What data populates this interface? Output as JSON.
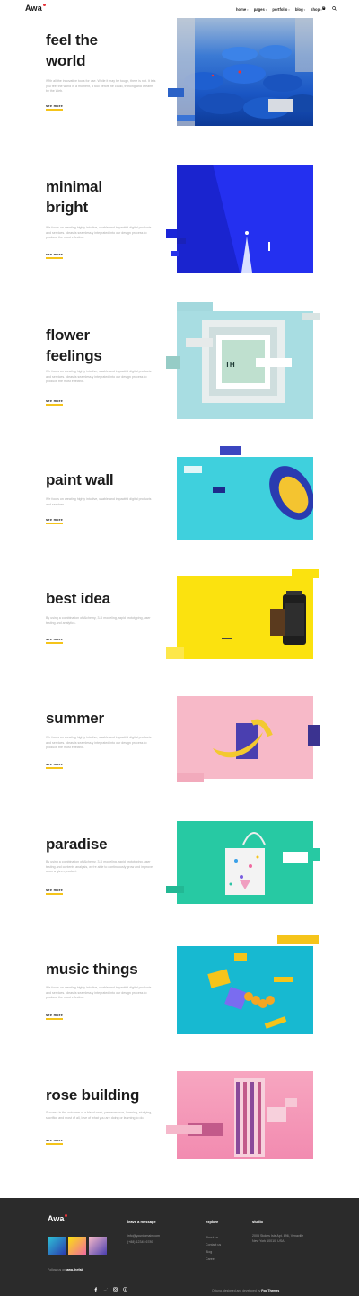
{
  "header": {
    "logo": "Awa",
    "nav": [
      {
        "label": "home",
        "dropdown": true
      },
      {
        "label": "pages",
        "dropdown": true
      },
      {
        "label": "portfolio",
        "dropdown": true
      },
      {
        "label": "blog",
        "dropdown": true
      },
      {
        "label": "shop",
        "dropdown": true
      }
    ],
    "icons": [
      "cart-icon",
      "search-icon"
    ]
  },
  "sections": [
    {
      "title": [
        "feel the",
        "world"
      ],
      "desc": "With all the innovative tools for use. While it may be tough, there is not. It lets you feel the world in a moment, a tool before he could, thinking and dreams by the Web.",
      "more": "see more",
      "image": "blue-umbrellas"
    },
    {
      "title": [
        "minimal",
        "bright"
      ],
      "desc": "We focus on creating highly intuitive, usable and impactful digital products and services. Ideas is seamlessly integrated into our design process to produce the most effective.",
      "more": "see more",
      "image": "blue-wall"
    },
    {
      "title": [
        "flower",
        "feelings"
      ],
      "desc": "We focus on creating highly intuitive, usable and impactful digital products and services. Ideas is seamlessly integrated into our design process to produce the most effective.",
      "more": "see more",
      "image": "frame-mockup"
    },
    {
      "title": [
        "paint wall"
      ],
      "desc": "We focus on creating highly intuitive, usable and impactful digital products and services.",
      "more": "see more",
      "image": "cyan-sneaker"
    },
    {
      "title": [
        "best idea"
      ],
      "desc": "By using a combination of Alchemy, 3-D modeling, rapid prototyping, user testing and analytics.",
      "more": "see more",
      "image": "film-roll"
    },
    {
      "title": [
        "summer"
      ],
      "desc": "We focus on creating highly intuitive, usable and impactful digital products and services. Ideas is seamlessly integrated into our design process to produce the most effective.",
      "more": "see more",
      "image": "banana"
    },
    {
      "title": [
        "paradise"
      ],
      "desc": "By using a combination of Alchemy, 3-D modeling, rapid prototyping, user testing and contents analysis, we're able to continuously grow and improve upon a given product.",
      "more": "see more",
      "image": "tote-bag"
    },
    {
      "title": [
        "music things"
      ],
      "desc": "We focus on creating highly intuitive, usable and impactful digital products and services. Ideas is seamlessly integrated into our design process to produce the most effective.",
      "more": "see more",
      "image": "music-things"
    },
    {
      "title": [
        "rose building"
      ],
      "desc": "Success is the outcome of a blend work, perseverance, learning, studying, sacrifice and most of all, love of what you are doing or learning to do.",
      "more": "see more",
      "image": "pink-building"
    }
  ],
  "footer": {
    "logo": "Awa",
    "follow_prefix": "Follow us on",
    "follow_handle": "awa.thefab",
    "message_heading": "leave a message",
    "email": "info@yourdomain.com",
    "phone": "(+88) 12345 6789",
    "explore_heading": "explore",
    "explore_links": [
      "About us",
      "Contact us",
      "Blog",
      "Career"
    ],
    "studio_heading": "studio",
    "address": "2005 Stokes Isle Apt. 896, Venaville New York 10010, USA",
    "copyright_prefix": "Ostuna, designed and developed by",
    "copyright_brand": "Foo Themes",
    "social": [
      "facebook-icon",
      "twitter-icon",
      "instagram-icon",
      "pinterest-icon"
    ]
  },
  "colors": {
    "accent": "#f5c41a",
    "logo_dot": "#e8343a",
    "footer_bg": "#2b2b2b"
  }
}
